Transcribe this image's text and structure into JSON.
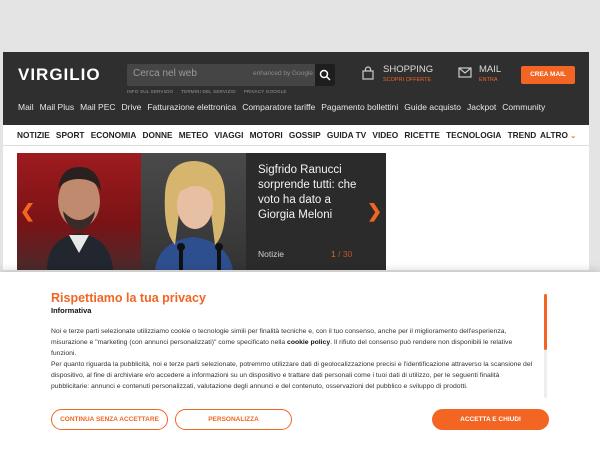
{
  "header": {
    "logo_text": "VIRGILIO",
    "search": {
      "placeholder": "Cerca nel web",
      "engine_label": "enhanced by Google",
      "links": [
        "INFO SUL SERVIZIO",
        "TERMINI DEL SERVIZIO",
        "PRIVACY GOOGLE"
      ]
    },
    "shopping": {
      "title": "SHOPPING",
      "subtitle": "SCOPRI OFFERTE"
    },
    "mail": {
      "title": "MAIL",
      "subtitle": "ENTRA"
    },
    "create_mail_label": "CREA MAIL",
    "services": [
      "Mail",
      "Mail Plus",
      "Mail PEC",
      "Drive",
      "Fatturazione elettronica",
      "Comparatore tariffe",
      "Pagamento bollettini",
      "Guide acquisto",
      "Jackpot",
      "Community"
    ]
  },
  "categories": [
    "NOTIZIE",
    "SPORT",
    "ECONOMIA",
    "DONNE",
    "METEO",
    "VIAGGI",
    "MOTORI",
    "GOSSIP",
    "GUIDA TV",
    "VIDEO",
    "RICETTE",
    "TECNOLOGIA",
    "TREND"
  ],
  "more_label": "ALTRO",
  "slider": {
    "title": "Sigfrido Ranucci sorprende tutti: che voto ha dato a Giorgia Meloni",
    "category": "Notizie",
    "current": "1",
    "total": "/ 30"
  },
  "privacy": {
    "title": "Rispettiamo la tua privacy",
    "subtitle": "Informativa",
    "para1": "Noi e terze parti selezionate utilizziamo cookie o tecnologie simili per finalità tecniche e, con il tuo consenso, anche per il miglioramento dell'esperienza, misurazione e \"marketing (con annunci personalizzati)\" come specificato nella",
    "cookie_policy": "cookie policy",
    "para1_end": ". Il rifiuto del consenso può rendere non disponibili le relative funzioni.",
    "para2": "Per quanto riguarda la pubblicità, noi e terze parti selezionate, potremmo utilizzare dati di geolocalizzazione precisi e l'identificazione attraverso la scansione del dispositivo, al fine di archiviare e/o accedere a informazioni su un dispositivo e trattare dati personali come i tuoi dati di utilizzo, per le seguenti finalità pubblicitarie: annunci e contenuti personalizzati, valutazione degli annunci e del contenuto, osservazioni del pubblico e sviluppo di prodotti.",
    "btn_reject": "CONTINUA SENZA ACCETTARE",
    "btn_customize": "PERSONALIZZA",
    "btn_accept": "ACCETTA E CHIUDI"
  },
  "colors": {
    "accent": "#f26522",
    "header_bg": "#2f2f2f"
  }
}
